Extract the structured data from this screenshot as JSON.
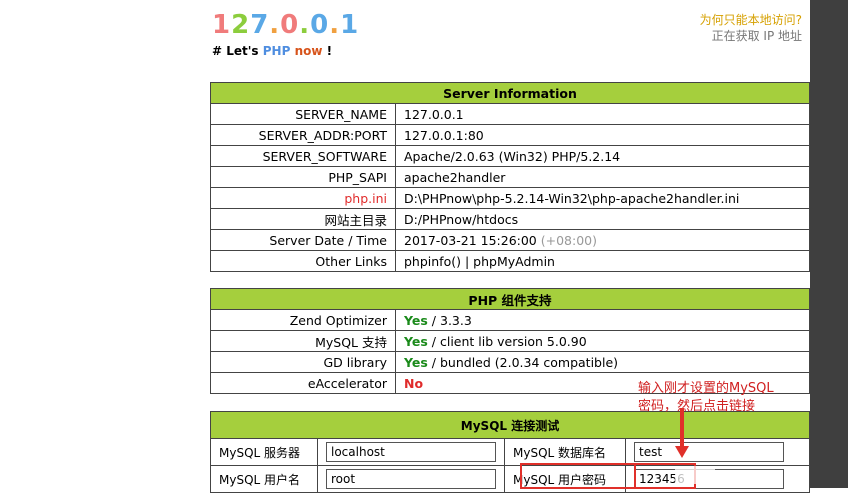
{
  "logo": {
    "chars": [
      {
        "text": "1",
        "color": "#f07b7b"
      },
      {
        "text": "2",
        "color": "#8ccd3d"
      },
      {
        "text": "7",
        "color": "#5aa8e6"
      },
      {
        "text": ".",
        "color": "#f0a040"
      },
      {
        "text": "0",
        "color": "#f07b7b"
      },
      {
        "text": ".",
        "color": "#8ccd3d"
      },
      {
        "text": "0",
        "color": "#5aa8e6"
      },
      {
        "text": ".",
        "color": "#f0a040"
      },
      {
        "text": "1",
        "color": "#5aa8e6"
      }
    ]
  },
  "tagline": {
    "prefix": "# Let's ",
    "php": "PHP",
    "space": " ",
    "now": "now",
    "suffix": " !"
  },
  "ip_panel": {
    "question": "为何只能本地访问?",
    "status": "正在获取 IP 地址"
  },
  "server_info": {
    "title": "Server Information",
    "rows": [
      {
        "key": "SERVER_NAME",
        "value": "127.0.0.1"
      },
      {
        "key": "SERVER_ADDR:PORT",
        "value": "127.0.0.1:80"
      },
      {
        "key": "SERVER_SOFTWARE",
        "value": "Apache/2.0.63 (Win32) PHP/5.2.14"
      },
      {
        "key": "PHP_SAPI",
        "value": "apache2handler"
      },
      {
        "key": "php.ini",
        "value": "D:\\PHPnow\\php-5.2.14-Win32\\php-apache2handler.ini"
      },
      {
        "key": "网站主目录",
        "value": "D:/PHPnow/htdocs"
      },
      {
        "key": "Server Date / Time",
        "value": "2017-03-21 15:26:00",
        "tz": "(+08:00)"
      },
      {
        "key": "Other Links",
        "link1": "phpinfo()",
        "sep": " | ",
        "link2": "phpMyAdmin"
      }
    ]
  },
  "components": {
    "title": "PHP 组件支持",
    "rows": [
      {
        "key": "Zend Optimizer",
        "status": "Yes",
        "detail": " / 3.3.3"
      },
      {
        "key": "MySQL 支持",
        "status": "Yes",
        "detail": " / client lib version 5.0.90"
      },
      {
        "key": "GD library",
        "status": "Yes",
        "detail": " / bundled (2.0.34 compatible)"
      },
      {
        "key": "eAccelerator",
        "status": "No",
        "detail": ""
      }
    ]
  },
  "mysql_test": {
    "title": "MySQL 连接测试",
    "server_label": "MySQL 服务器",
    "server_value": "localhost",
    "dbname_label": "MySQL 数据库名",
    "dbname_value": "test",
    "user_label": "MySQL 用户名",
    "user_value": "root",
    "pwd_label": "MySQL 用户密码",
    "pwd_value": "123456"
  },
  "annotation": {
    "line1": "输入刚才设置的MySQL",
    "line2": "密码，然后点击链接"
  }
}
